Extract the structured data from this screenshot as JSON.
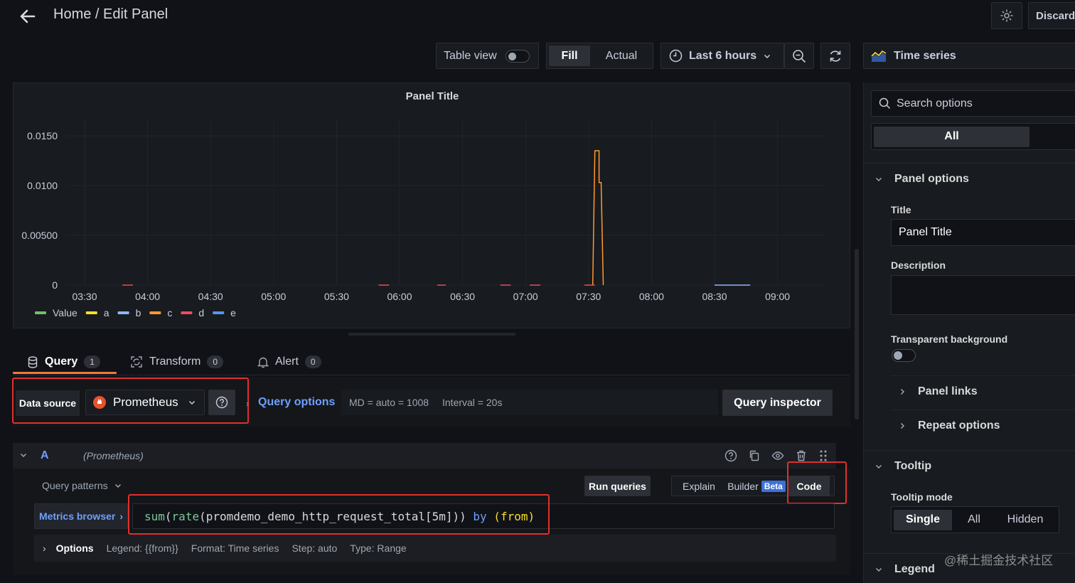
{
  "header": {
    "breadcrumb": "Home / Edit Panel",
    "discard_label": "Discard"
  },
  "toolbar": {
    "table_view_label": "Table view",
    "table_view_on": false,
    "fill_label": "Fill",
    "actual_label": "Actual",
    "time_range_label": "Last 6 hours",
    "visualization_label": "Time series"
  },
  "panel": {
    "title": "Panel Title"
  },
  "chart_data": {
    "type": "line",
    "title": "Panel Title",
    "x_ticks": [
      "03:30",
      "04:00",
      "04:30",
      "05:00",
      "05:30",
      "06:00",
      "06:30",
      "07:00",
      "07:30",
      "08:00",
      "08:30",
      "09:00"
    ],
    "y_ticks": [
      "0",
      "0.00500",
      "0.0100",
      "0.0150"
    ],
    "ylim": [
      0,
      0.016
    ],
    "grid": true,
    "legend_position": "bottom-left",
    "series": [
      {
        "name": "Value",
        "color": "#73bf69",
        "points": []
      },
      {
        "name": "a",
        "color": "#fade2a",
        "points": []
      },
      {
        "name": "b",
        "color": "#8ab8ff",
        "points": [
          [
            "08:30",
            0
          ],
          [
            "08:47",
            0
          ]
        ]
      },
      {
        "name": "c",
        "color": "#ff9830",
        "points": [
          [
            "07:32",
            0
          ],
          [
            "07:33",
            0.0135
          ],
          [
            "07:35",
            0.0135
          ],
          [
            "07:35",
            0.0103
          ],
          [
            "07:36",
            0.0103
          ],
          [
            "07:37",
            0
          ]
        ]
      },
      {
        "name": "d",
        "color": "#f2495c",
        "points": [
          [
            "03:48",
            0
          ],
          [
            "03:53",
            0
          ],
          [
            "05:50",
            0
          ],
          [
            "05:55",
            0
          ],
          [
            "06:18",
            0
          ],
          [
            "06:22",
            0
          ],
          [
            "06:48",
            0
          ],
          [
            "06:53",
            0
          ],
          [
            "07:02",
            0
          ],
          [
            "07:07",
            0
          ],
          [
            "07:28",
            0
          ],
          [
            "07:33",
            0
          ]
        ]
      },
      {
        "name": "e",
        "color": "#5794f2",
        "points": []
      }
    ]
  },
  "tabs": [
    {
      "label": "Query",
      "count": "1"
    },
    {
      "label": "Transform",
      "count": "0"
    },
    {
      "label": "Alert",
      "count": "0"
    }
  ],
  "datasource": {
    "label": "Data source",
    "name": "Prometheus",
    "query_options_label": "Query options",
    "md_text": "MD = auto = 1008",
    "interval_text": "Interval = 20s",
    "query_inspector_label": "Query inspector"
  },
  "query": {
    "ref_id": "A",
    "datasource_name": "(Prometheus)",
    "patterns_label": "Query patterns",
    "run_label": "Run queries",
    "explain_label": "Explain",
    "builder_label": "Builder",
    "beta_label": "Beta",
    "code_label": "Code",
    "metrics_browser_label": "Metrics browser",
    "expr": {
      "fn1": "sum",
      "fn2": "rate",
      "metric": "promdemo_demo_http_request_total[5m]",
      "by_kw": "by",
      "by_label": "from"
    },
    "options_label": "Options",
    "legend_text": "Legend: {{from}}",
    "format_text": "Format: Time series",
    "step_text": "Step: auto",
    "type_text": "Type: Range"
  },
  "sidebar": {
    "search_placeholder": "Search options",
    "all_label": "All",
    "panel_options_label": "Panel options",
    "title_field_label": "Title",
    "title_value": "Panel Title",
    "description_label": "Description",
    "transparent_label": "Transparent background",
    "panel_links_label": "Panel links",
    "repeat_options_label": "Repeat options",
    "tooltip_label": "Tooltip",
    "tooltip_mode_label": "Tooltip mode",
    "tooltip_modes": [
      "Single",
      "All",
      "Hidden"
    ],
    "legend_label": "Legend"
  },
  "watermark": "@稀土掘金技术社区",
  "colors": {
    "accent_blue": "#6e9fff",
    "tab_underline": "#f27a38",
    "highlight_red": "#e02f2f"
  }
}
